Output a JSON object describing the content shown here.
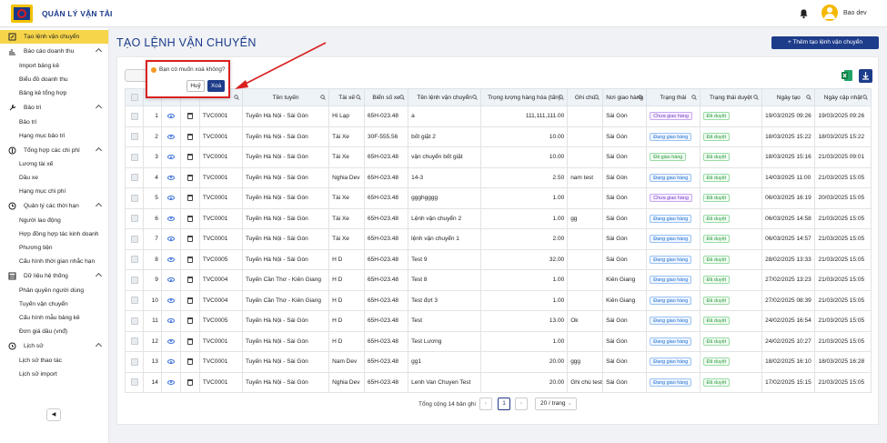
{
  "app": {
    "title": "QUẢN LÝ VẬN TẢI",
    "user": "Bao dev"
  },
  "sidebar": {
    "items": [
      {
        "label": "Tạo lệnh vận chuyển",
        "kind": "group",
        "icon": "document-icon",
        "active": true
      },
      {
        "label": "Báo cáo doanh thu",
        "kind": "group",
        "icon": "bar-chart-icon",
        "chevron": true
      },
      {
        "label": "Import bảng kê",
        "kind": "sub"
      },
      {
        "label": "Biểu đồ doanh thu",
        "kind": "sub"
      },
      {
        "label": "Bảng kê tổng hợp",
        "kind": "sub"
      },
      {
        "label": "Bảo trì",
        "kind": "group",
        "icon": "wrench-icon",
        "chevron": true
      },
      {
        "label": "Bảo trì",
        "kind": "sub"
      },
      {
        "label": "Hạng mục bảo trì",
        "kind": "sub"
      },
      {
        "label": "Tổng hợp các chi phí",
        "kind": "group",
        "icon": "dollar-icon",
        "chevron": true
      },
      {
        "label": "Lương tài xế",
        "kind": "sub"
      },
      {
        "label": "Dầu xe",
        "kind": "sub"
      },
      {
        "label": "Hạng mục chi phí",
        "kind": "sub"
      },
      {
        "label": "Quản lý các thời hạn",
        "kind": "group",
        "icon": "clock-icon",
        "chevron": true
      },
      {
        "label": "Người lao động",
        "kind": "sub"
      },
      {
        "label": "Hợp đồng hợp tác kinh doanh",
        "kind": "sub"
      },
      {
        "label": "Phương tiện",
        "kind": "sub"
      },
      {
        "label": "Cấu hình thời gian nhắc hạn",
        "kind": "sub"
      },
      {
        "label": "Dữ liệu hệ thống",
        "kind": "group",
        "icon": "database-icon",
        "chevron": true
      },
      {
        "label": "Phân quyền người dùng",
        "kind": "sub"
      },
      {
        "label": "Tuyến vận chuyển",
        "kind": "sub"
      },
      {
        "label": "Cấu hình mẫu bảng kê",
        "kind": "sub"
      },
      {
        "label": "Đơn giá dầu (vnđ)",
        "kind": "sub"
      },
      {
        "label": "Lịch sử",
        "kind": "group",
        "icon": "history-icon",
        "chevron": true
      },
      {
        "label": "Lịch sử thao tác",
        "kind": "sub"
      },
      {
        "label": "Lịch sử import",
        "kind": "sub"
      }
    ]
  },
  "page": {
    "title": "TẠO LỆNH VẬN CHUYỂN",
    "add_button": "+ Thêm tạo lệnh vận chuyển"
  },
  "popconfirm": {
    "message": "Bạn có muốn xoá không?",
    "cancel": "Huỷ",
    "ok": "Xoá"
  },
  "table": {
    "columns": [
      "",
      "",
      "",
      "",
      "Tên tuyến",
      "Tài xế",
      "Biển số xe",
      "Tên lệnh vận chuyển",
      "Trọng lượng hàng hóa (tấn)",
      "Ghi chú",
      "Nơi giao hàng",
      "Trạng thái",
      "Trạng thái duyệt",
      "Ngày tạo",
      "Ngày cập nhật"
    ],
    "rows": [
      [
        "1",
        "TVC0001",
        "Tuyến Hà Nội - Sài Gòn",
        "Hi Lạp",
        "65H-023.48",
        "a",
        "111,111,111.00",
        "",
        "Sài Gòn",
        "Chưa giao hàng",
        "Đã duyệt",
        "19/03/2025 09:26",
        "19/03/2025 09:26"
      ],
      [
        "2",
        "TVC0001",
        "Tuyến Hà Nội - Sài Gòn",
        "Tài Xe",
        "30F-555.56",
        "bốt giặt 2",
        "10.00",
        "",
        "Sài Gòn",
        "Đang giao hàng",
        "Đã duyệt",
        "18/03/2025 15:22",
        "18/03/2025 15:22"
      ],
      [
        "3",
        "TVC0001",
        "Tuyến Hà Nội - Sài Gòn",
        "Tài Xe",
        "65H-023.48",
        "vận chuyển bốt giặt",
        "10.00",
        "",
        "Sài Gòn",
        "Đã giao hàng",
        "Đã duyệt",
        "18/03/2025 15:16",
        "21/03/2025 09:01"
      ],
      [
        "4",
        "TVC0001",
        "Tuyến Hà Nội - Sài Gòn",
        "Nghia Dev",
        "65H-023.48",
        "14-3",
        "2.50",
        "nam test",
        "Sài Gòn",
        "Đang giao hàng",
        "Đã duyệt",
        "14/03/2025 11:00",
        "21/03/2025 15:05"
      ],
      [
        "5",
        "TVC0001",
        "Tuyến Hà Nội - Sài Gòn",
        "Tài Xe",
        "65H-023.48",
        "ggghgggg",
        "1.00",
        "",
        "Sài Gòn",
        "Chưa giao hàng",
        "Đã duyệt",
        "06/03/2025 16:19",
        "20/03/2025 15:05"
      ],
      [
        "6",
        "TVC0001",
        "Tuyến Hà Nội - Sài Gòn",
        "Tài Xe",
        "65H-023.48",
        "Lệnh vận chuyển 2",
        "1.00",
        "gg",
        "Sài Gòn",
        "Đang giao hàng",
        "Đã duyệt",
        "06/03/2025 14:58",
        "21/03/2025 15:05"
      ],
      [
        "7",
        "TVC0001",
        "Tuyến Hà Nội - Sài Gòn",
        "Tài Xe",
        "65H-023.48",
        "lệnh vận chuyển 1",
        "2.00",
        "",
        "Sài Gòn",
        "Đang giao hàng",
        "Đã duyệt",
        "06/03/2025 14:57",
        "21/03/2025 15:05"
      ],
      [
        "8",
        "TVC0005",
        "Tuyến Hà Nội - Sài Gòn",
        "H D",
        "65H-023.48",
        "Test 9",
        "32.00",
        "",
        "Sài Gòn",
        "Đang giao hàng",
        "Đã duyệt",
        "28/02/2025 13:33",
        "21/03/2025 15:05"
      ],
      [
        "9",
        "TVC0004",
        "Tuyến Cần Thơ - Kiên Giang",
        "H D",
        "65H-023.48",
        "Test 8",
        "1.00",
        "",
        "Kiên Giang",
        "Đang giao hàng",
        "Đã duyệt",
        "27/02/2025 13:23",
        "21/03/2025 15:05"
      ],
      [
        "10",
        "TVC0004",
        "Tuyến Cần Thơ - Kiên Giang",
        "H D",
        "65H-023.48",
        "Test đợt 3",
        "1.00",
        "",
        "Kiên Giang",
        "Đang giao hàng",
        "Đã duyệt",
        "27/02/2025 08:39",
        "21/03/2025 15:05"
      ],
      [
        "11",
        "TVC0005",
        "Tuyến Hà Nội - Sài Gòn",
        "H D",
        "65H-023.48",
        "Test",
        "13.00",
        "Ok",
        "Sài Gòn",
        "Đang giao hàng",
        "Đã duyệt",
        "24/02/2025 16:54",
        "21/03/2025 15:05"
      ],
      [
        "12",
        "TVC0001",
        "Tuyến Hà Nội - Sài Gòn",
        "H D",
        "65H-023.48",
        "Test Lương",
        "1.00",
        "",
        "Sài Gòn",
        "Đang giao hàng",
        "Đã duyệt",
        "24/02/2025 10:27",
        "21/03/2025 15:05"
      ],
      [
        "13",
        "TVC0001",
        "Tuyến Hà Nội - Sài Gòn",
        "Nam Dev",
        "65H-023.48",
        "gg1",
        "20.00",
        "ggg",
        "Sài Gòn",
        "Đang giao hàng",
        "Đã duyệt",
        "18/02/2025 16:10",
        "18/03/2025 16:28"
      ],
      [
        "14",
        "TVC0001",
        "Tuyến Hà Nội - Sài Gòn",
        "Nghia Dev",
        "65H-023.48",
        "Lenh Van Chuyen Test",
        "20.00",
        "Ghi chú test",
        "Sài Gòn",
        "Đang giao hàng",
        "Đã duyệt",
        "17/02/2025 15:15",
        "21/03/2025 15:05"
      ]
    ]
  },
  "pagination": {
    "total": "Tổng cộng 14 bản ghi",
    "current_page": "1",
    "page_size": "20 / trang"
  },
  "colors": {
    "brand": "#1d3c8a",
    "active_menu": "#f7d54a",
    "annotation": "#d92020"
  }
}
